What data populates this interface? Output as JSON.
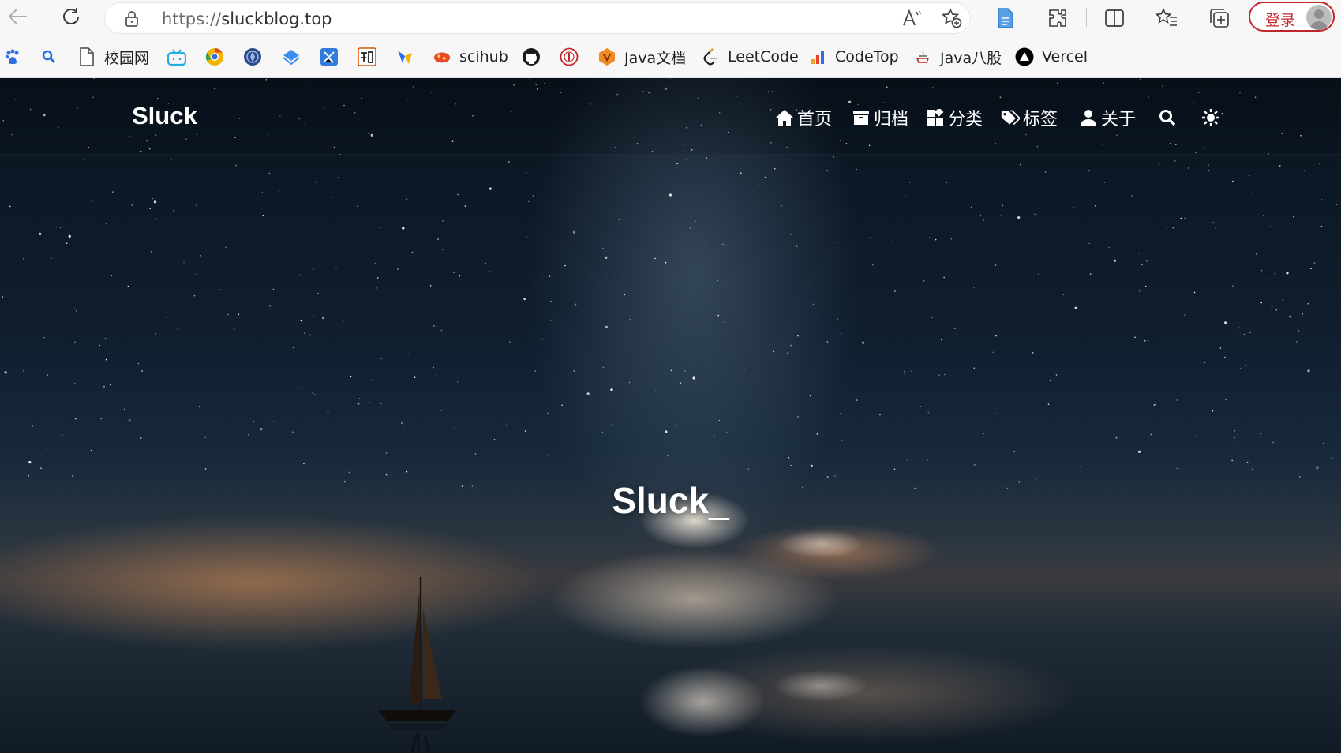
{
  "browser": {
    "url_scheme": "https://",
    "url_host": "sluckblog.top",
    "login_label": "登录",
    "icons": [
      "back-icon",
      "refresh-icon",
      "lock-icon",
      "read-aloud-icon",
      "add-favorite-icon",
      "page-icon",
      "extensions-icon",
      "split-screen-icon",
      "favorites-icon",
      "collections-icon",
      "avatar"
    ]
  },
  "bookmarks": [
    {
      "label": "",
      "icon": "baidu-icon"
    },
    {
      "label": "",
      "icon": "search-icon"
    },
    {
      "label": "校园网",
      "icon": "page-icon"
    },
    {
      "label": "",
      "icon": "bilibili-icon"
    },
    {
      "label": "",
      "icon": "chrome-like-icon"
    },
    {
      "label": "",
      "icon": "globe-emblem-icon"
    },
    {
      "label": "",
      "icon": "diamond-icon"
    },
    {
      "label": "",
      "icon": "puzzle-app-icon"
    },
    {
      "label": "",
      "icon": "zhihu-icon"
    },
    {
      "label": "",
      "icon": "bird-icon"
    },
    {
      "label": "scihub",
      "icon": "scihub-icon"
    },
    {
      "label": "",
      "icon": "github-icon"
    },
    {
      "label": "",
      "icon": "seal-icon"
    },
    {
      "label": "Java文档",
      "icon": "java-doc-icon"
    },
    {
      "label": "LeetCode",
      "icon": "leetcode-icon"
    },
    {
      "label": "CodeTop",
      "icon": "codetop-icon"
    },
    {
      "label": "Java八股",
      "icon": "java-bagu-icon"
    },
    {
      "label": "Vercel",
      "icon": "vercel-icon"
    }
  ],
  "site": {
    "brand": "Sluck",
    "menu": [
      {
        "label": "首页",
        "icon": "home-icon"
      },
      {
        "label": "归档",
        "icon": "archive-icon"
      },
      {
        "label": "分类",
        "icon": "category-icon"
      },
      {
        "label": "标签",
        "icon": "tags-icon"
      },
      {
        "label": "关于",
        "icon": "user-icon"
      }
    ],
    "hero_title": "Sluck",
    "hero_cursor": "_"
  }
}
